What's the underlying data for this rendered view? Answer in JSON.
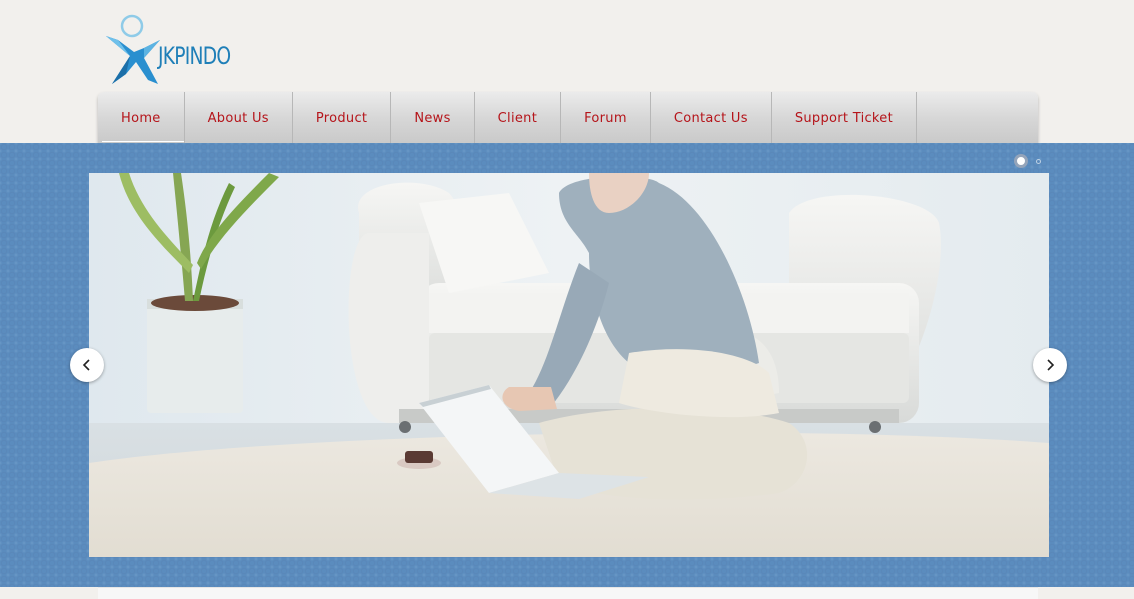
{
  "brand": {
    "name": "JKPINDO",
    "logo_icon": "person-x-logo-icon",
    "colors": {
      "logo_blue": "#1f7fb8",
      "logo_light": "#7ec8ec"
    }
  },
  "nav": {
    "items": [
      {
        "label": "Home",
        "active": true
      },
      {
        "label": "About Us"
      },
      {
        "label": "Product"
      },
      {
        "label": "News"
      },
      {
        "label": "Client"
      },
      {
        "label": "Forum"
      },
      {
        "label": "Contact Us"
      },
      {
        "label": "Support Ticket"
      }
    ],
    "text_color": "#b5141a"
  },
  "slider": {
    "slide_icon": "woman-with-laptop-photo",
    "prev_icon": "chevron-left-icon",
    "next_icon": "chevron-right-icon",
    "pagination": {
      "total": 2,
      "active": 1
    },
    "band_color": "#5b8cbe"
  }
}
